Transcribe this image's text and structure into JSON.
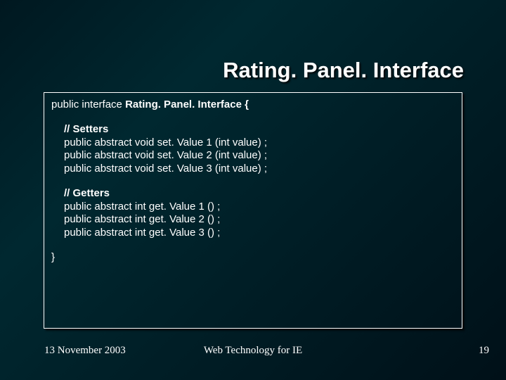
{
  "title": "Rating. Panel. Interface",
  "code": {
    "decl_prefix": "public interface ",
    "decl_name": "Rating. Panel. Interface {",
    "setters_hdr": "// Setters",
    "setter_lines": [
      "public abstract void set. Value 1 (int value) ;",
      "public abstract void set. Value 2 (int value) ;",
      "public abstract void set. Value 3 (int value) ;"
    ],
    "getters_hdr": "// Getters",
    "getter_lines": [
      "public abstract int get. Value 1 () ;",
      "public abstract int get. Value 2 () ;",
      "public abstract int get. Value 3 () ;"
    ],
    "close": "}"
  },
  "footer": {
    "date": "13 November 2003",
    "center": "Web Technology for IE",
    "page": "19"
  }
}
